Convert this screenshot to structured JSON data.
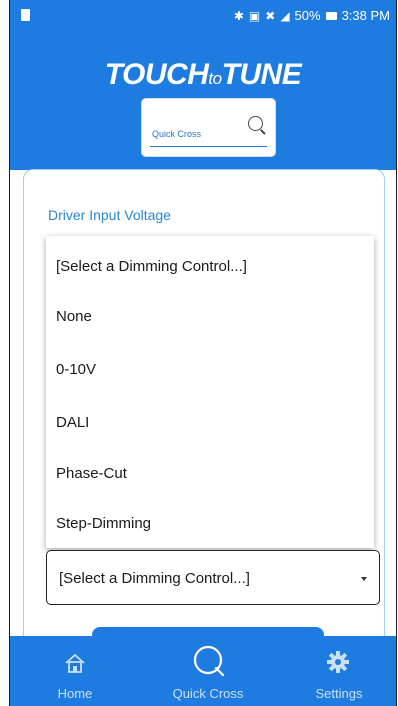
{
  "status_bar": {
    "battery_percent": "50%",
    "time": "3:38 PM",
    "icons": [
      "app-icon",
      "bluetooth-icon",
      "nfc-icon",
      "mute-icon",
      "signal-icon",
      "battery-icon"
    ]
  },
  "header": {
    "logo_part1": "TOUCH",
    "logo_part2": "to",
    "logo_part3": "TUNE"
  },
  "quick_cross_search": {
    "placeholder": "Quick Cross",
    "icon": "search-icon"
  },
  "card": {
    "section_title": "Driver Input Voltage"
  },
  "dropdown": {
    "options": [
      "[Select a Dimming Control...]",
      "None",
      "0-10V",
      "DALI",
      "Phase-Cut",
      "Step-Dimming"
    ]
  },
  "dimming_select": {
    "value": "[Select a Dimming Control...]"
  },
  "bottom_nav": {
    "items": [
      {
        "label": "Home",
        "icon": "home-icon"
      },
      {
        "label": "Quick Cross",
        "icon": "quick-cross-icon"
      },
      {
        "label": "Settings",
        "icon": "gear-icon"
      }
    ]
  },
  "colors": {
    "brand_blue": "#1e7ce0",
    "title_blue": "#2a86d6",
    "nav_text": "#c9e0f7"
  }
}
